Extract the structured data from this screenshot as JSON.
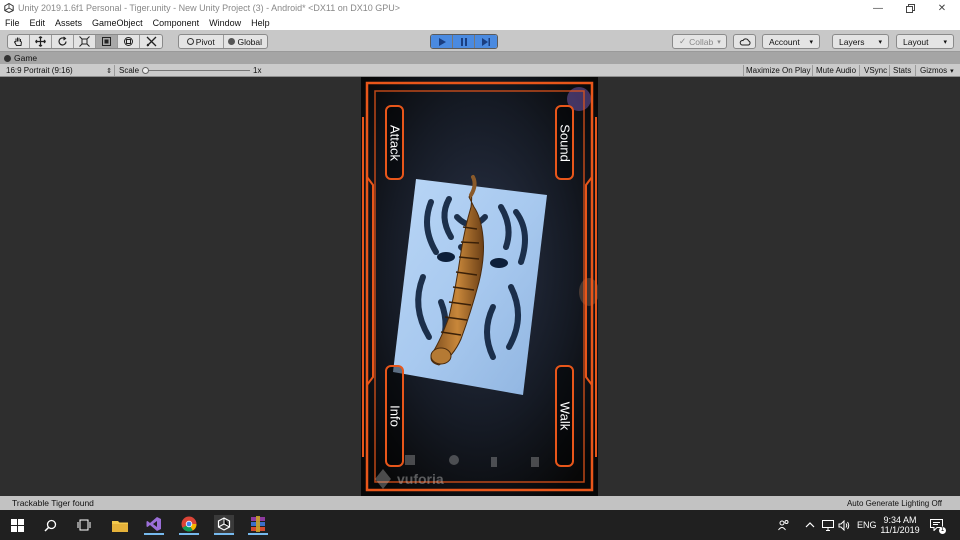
{
  "window": {
    "title": "Unity 2019.1.6f1 Personal - Tiger.unity - New Unity Project (3) - Android* <DX11 on DX10 GPU>",
    "minimize_icon": "minimize-icon",
    "restore_icon": "restore-icon",
    "close_icon": "close-icon"
  },
  "menu": {
    "items": [
      "File",
      "Edit",
      "Assets",
      "GameObject",
      "Component",
      "Window",
      "Help"
    ]
  },
  "toolbar": {
    "tools": [
      "hand-tool-icon",
      "move-tool-icon",
      "rotate-tool-icon",
      "scale-tool-icon",
      "rect-tool-icon",
      "transform-tool-icon",
      "custom-tool-icon"
    ],
    "pivot_label": "Pivot",
    "global_label": "Global",
    "collab_label": "Collab",
    "account_label": "Account",
    "layers_label": "Layers",
    "layout_label": "Layout",
    "play_color": "#4a8ae0"
  },
  "game_view": {
    "tab_label": "Game",
    "aspect_label": "16:9 Portrait (9:16)",
    "scale_label": "Scale",
    "scale_value": "1x",
    "options": [
      "Maximize On Play",
      "Mute Audio",
      "VSync",
      "Stats",
      "Gizmos"
    ]
  },
  "app": {
    "attack_label": "Attack",
    "sound_label": "Sound",
    "info_label": "Info",
    "walk_label": "Walk",
    "watermark": "vuforia",
    "frame_color": "#e8561a"
  },
  "status": {
    "message": "Trackable Tiger found",
    "lighting": "Auto Generate Lighting Off"
  },
  "taskbar": {
    "time": "9:34 AM",
    "date": "11/1/2019",
    "language": "ENG",
    "apps": [
      "windows-start-icon",
      "search-icon",
      "task-view-icon",
      "file-explorer-icon",
      "visual-studio-icon",
      "chrome-icon",
      "unity-icon",
      "winrar-icon"
    ]
  }
}
